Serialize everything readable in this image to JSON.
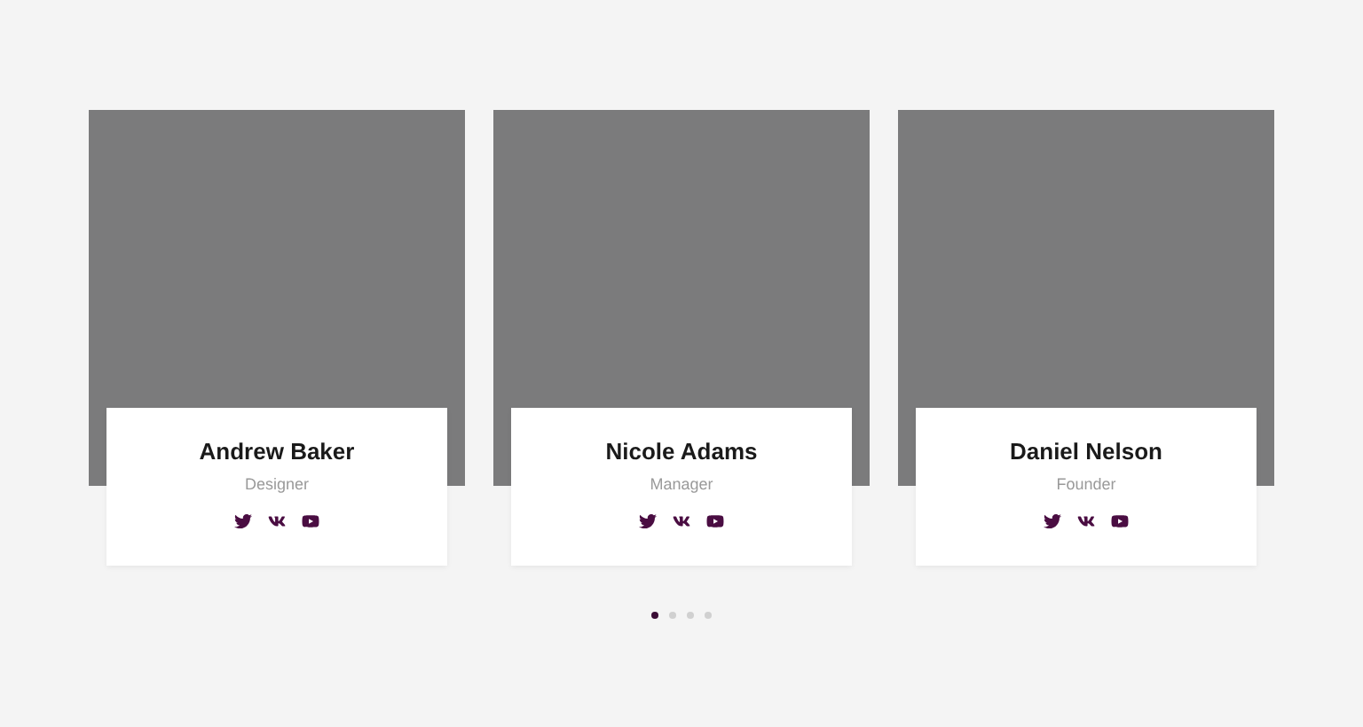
{
  "members": [
    {
      "name": "Andrew Baker",
      "role": "Designer",
      "socials": [
        {
          "kind": "twitter"
        },
        {
          "kind": "vk"
        },
        {
          "kind": "youtube"
        }
      ]
    },
    {
      "name": "Nicole Adams",
      "role": "Manager",
      "socials": [
        {
          "kind": "twitter"
        },
        {
          "kind": "vk"
        },
        {
          "kind": "youtube"
        }
      ]
    },
    {
      "name": "Daniel Nelson",
      "role": "Founder",
      "socials": [
        {
          "kind": "twitter"
        },
        {
          "kind": "vk"
        },
        {
          "kind": "youtube"
        }
      ]
    }
  ],
  "pagination": [
    {
      "selected": true
    },
    {
      "selected": false
    },
    {
      "selected": false
    },
    {
      "selected": false
    }
  ]
}
